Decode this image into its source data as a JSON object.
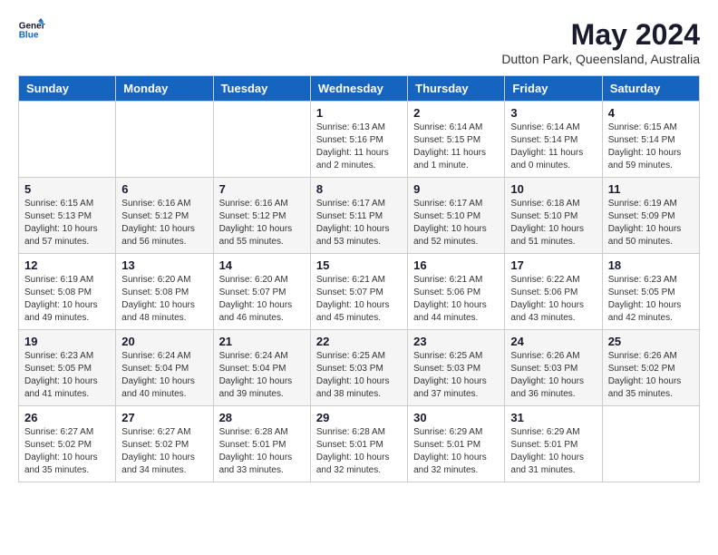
{
  "header": {
    "logo_general": "General",
    "logo_blue": "Blue",
    "month_year": "May 2024",
    "location": "Dutton Park, Queensland, Australia"
  },
  "days_of_week": [
    "Sunday",
    "Monday",
    "Tuesday",
    "Wednesday",
    "Thursday",
    "Friday",
    "Saturday"
  ],
  "weeks": [
    [
      {
        "day": "",
        "sunrise": "",
        "sunset": "",
        "daylight": ""
      },
      {
        "day": "",
        "sunrise": "",
        "sunset": "",
        "daylight": ""
      },
      {
        "day": "",
        "sunrise": "",
        "sunset": "",
        "daylight": ""
      },
      {
        "day": "1",
        "sunrise": "Sunrise: 6:13 AM",
        "sunset": "Sunset: 5:16 PM",
        "daylight": "Daylight: 11 hours and 2 minutes."
      },
      {
        "day": "2",
        "sunrise": "Sunrise: 6:14 AM",
        "sunset": "Sunset: 5:15 PM",
        "daylight": "Daylight: 11 hours and 1 minute."
      },
      {
        "day": "3",
        "sunrise": "Sunrise: 6:14 AM",
        "sunset": "Sunset: 5:14 PM",
        "daylight": "Daylight: 11 hours and 0 minutes."
      },
      {
        "day": "4",
        "sunrise": "Sunrise: 6:15 AM",
        "sunset": "Sunset: 5:14 PM",
        "daylight": "Daylight: 10 hours and 59 minutes."
      }
    ],
    [
      {
        "day": "5",
        "sunrise": "Sunrise: 6:15 AM",
        "sunset": "Sunset: 5:13 PM",
        "daylight": "Daylight: 10 hours and 57 minutes."
      },
      {
        "day": "6",
        "sunrise": "Sunrise: 6:16 AM",
        "sunset": "Sunset: 5:12 PM",
        "daylight": "Daylight: 10 hours and 56 minutes."
      },
      {
        "day": "7",
        "sunrise": "Sunrise: 6:16 AM",
        "sunset": "Sunset: 5:12 PM",
        "daylight": "Daylight: 10 hours and 55 minutes."
      },
      {
        "day": "8",
        "sunrise": "Sunrise: 6:17 AM",
        "sunset": "Sunset: 5:11 PM",
        "daylight": "Daylight: 10 hours and 53 minutes."
      },
      {
        "day": "9",
        "sunrise": "Sunrise: 6:17 AM",
        "sunset": "Sunset: 5:10 PM",
        "daylight": "Daylight: 10 hours and 52 minutes."
      },
      {
        "day": "10",
        "sunrise": "Sunrise: 6:18 AM",
        "sunset": "Sunset: 5:10 PM",
        "daylight": "Daylight: 10 hours and 51 minutes."
      },
      {
        "day": "11",
        "sunrise": "Sunrise: 6:19 AM",
        "sunset": "Sunset: 5:09 PM",
        "daylight": "Daylight: 10 hours and 50 minutes."
      }
    ],
    [
      {
        "day": "12",
        "sunrise": "Sunrise: 6:19 AM",
        "sunset": "Sunset: 5:08 PM",
        "daylight": "Daylight: 10 hours and 49 minutes."
      },
      {
        "day": "13",
        "sunrise": "Sunrise: 6:20 AM",
        "sunset": "Sunset: 5:08 PM",
        "daylight": "Daylight: 10 hours and 48 minutes."
      },
      {
        "day": "14",
        "sunrise": "Sunrise: 6:20 AM",
        "sunset": "Sunset: 5:07 PM",
        "daylight": "Daylight: 10 hours and 46 minutes."
      },
      {
        "day": "15",
        "sunrise": "Sunrise: 6:21 AM",
        "sunset": "Sunset: 5:07 PM",
        "daylight": "Daylight: 10 hours and 45 minutes."
      },
      {
        "day": "16",
        "sunrise": "Sunrise: 6:21 AM",
        "sunset": "Sunset: 5:06 PM",
        "daylight": "Daylight: 10 hours and 44 minutes."
      },
      {
        "day": "17",
        "sunrise": "Sunrise: 6:22 AM",
        "sunset": "Sunset: 5:06 PM",
        "daylight": "Daylight: 10 hours and 43 minutes."
      },
      {
        "day": "18",
        "sunrise": "Sunrise: 6:23 AM",
        "sunset": "Sunset: 5:05 PM",
        "daylight": "Daylight: 10 hours and 42 minutes."
      }
    ],
    [
      {
        "day": "19",
        "sunrise": "Sunrise: 6:23 AM",
        "sunset": "Sunset: 5:05 PM",
        "daylight": "Daylight: 10 hours and 41 minutes."
      },
      {
        "day": "20",
        "sunrise": "Sunrise: 6:24 AM",
        "sunset": "Sunset: 5:04 PM",
        "daylight": "Daylight: 10 hours and 40 minutes."
      },
      {
        "day": "21",
        "sunrise": "Sunrise: 6:24 AM",
        "sunset": "Sunset: 5:04 PM",
        "daylight": "Daylight: 10 hours and 39 minutes."
      },
      {
        "day": "22",
        "sunrise": "Sunrise: 6:25 AM",
        "sunset": "Sunset: 5:03 PM",
        "daylight": "Daylight: 10 hours and 38 minutes."
      },
      {
        "day": "23",
        "sunrise": "Sunrise: 6:25 AM",
        "sunset": "Sunset: 5:03 PM",
        "daylight": "Daylight: 10 hours and 37 minutes."
      },
      {
        "day": "24",
        "sunrise": "Sunrise: 6:26 AM",
        "sunset": "Sunset: 5:03 PM",
        "daylight": "Daylight: 10 hours and 36 minutes."
      },
      {
        "day": "25",
        "sunrise": "Sunrise: 6:26 AM",
        "sunset": "Sunset: 5:02 PM",
        "daylight": "Daylight: 10 hours and 35 minutes."
      }
    ],
    [
      {
        "day": "26",
        "sunrise": "Sunrise: 6:27 AM",
        "sunset": "Sunset: 5:02 PM",
        "daylight": "Daylight: 10 hours and 35 minutes."
      },
      {
        "day": "27",
        "sunrise": "Sunrise: 6:27 AM",
        "sunset": "Sunset: 5:02 PM",
        "daylight": "Daylight: 10 hours and 34 minutes."
      },
      {
        "day": "28",
        "sunrise": "Sunrise: 6:28 AM",
        "sunset": "Sunset: 5:01 PM",
        "daylight": "Daylight: 10 hours and 33 minutes."
      },
      {
        "day": "29",
        "sunrise": "Sunrise: 6:28 AM",
        "sunset": "Sunset: 5:01 PM",
        "daylight": "Daylight: 10 hours and 32 minutes."
      },
      {
        "day": "30",
        "sunrise": "Sunrise: 6:29 AM",
        "sunset": "Sunset: 5:01 PM",
        "daylight": "Daylight: 10 hours and 32 minutes."
      },
      {
        "day": "31",
        "sunrise": "Sunrise: 6:29 AM",
        "sunset": "Sunset: 5:01 PM",
        "daylight": "Daylight: 10 hours and 31 minutes."
      },
      {
        "day": "",
        "sunrise": "",
        "sunset": "",
        "daylight": ""
      }
    ]
  ]
}
